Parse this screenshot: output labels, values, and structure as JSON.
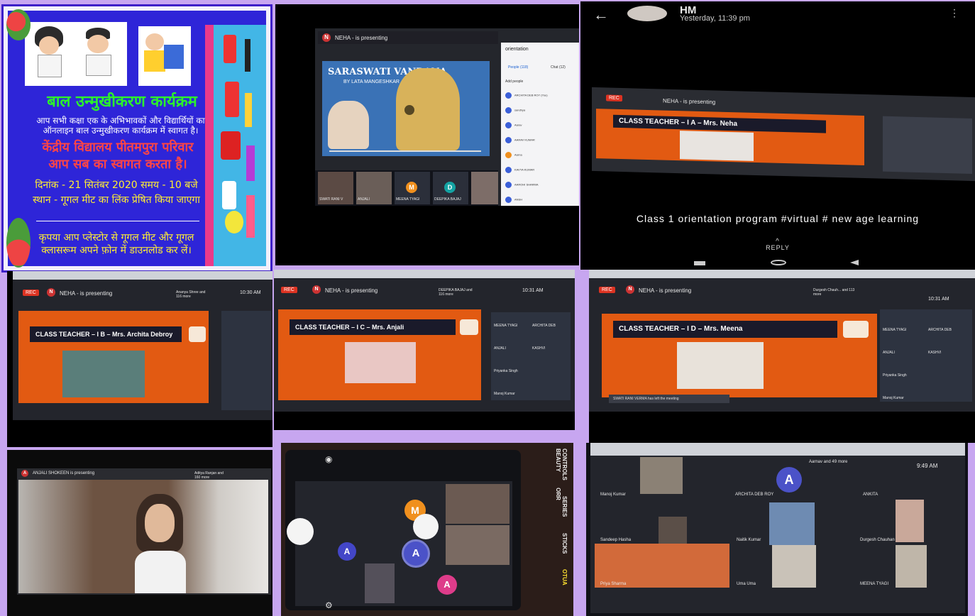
{
  "poster": {
    "title": "बाल उन्मुखीकरण कार्यक्रम",
    "line1": "आप सभी कक्षा एक के अभिभावकों और विद्यार्थियों का",
    "line2": "ऑनलाइन बाल उन्मुखीकरण कार्यक्रम में स्वागत है।",
    "school1": "केंद्रीय विद्यालय पीतमपुरा परिवार",
    "school2": "आप सब का स्वागत करता है।",
    "date": "दिनांक - 21 सितंबर 2020  समय - 10 बजे",
    "place": "स्थान - गूगल मीट का लिंक प्रेषित किया जाएगा",
    "note1": "कृपया आप प्लेस्टोर से गूगल मीट और गूगल",
    "note2": "क्लासरूम अपने फ़ोन में डाउनलोड कर लें।"
  },
  "vandana": {
    "presenter": "NEHA - is presenting",
    "video_title": "SARASWATI VANDANA",
    "video_sub": "BY LATA MANGESHKAR",
    "panel_title": "orientation",
    "tab_people": "People (118)",
    "tab_chat": "Chat (12)",
    "add_people": "Add people",
    "people": [
      "ARCHITA DEB ROY (You)",
      "sandhya",
      "Aarav",
      "AARAV KUMAR",
      "Aarna",
      "KAVYA KUMAR",
      "AAROHI SHARMA",
      "ANSH"
    ],
    "thumbs": [
      "SWATI RANI V",
      "ANJALI",
      "MEENA TYAGI",
      "DEEPIKA BAJAJ"
    ],
    "thumb_letters": [
      "M",
      "D"
    ]
  },
  "hm": {
    "name": "HM",
    "time": "Yesterday, 11:39 pm",
    "presenter": "NEHA - is presenting",
    "slide": "CLASS TEACHER – I A – Mrs. Neha",
    "caption": "Class 1 orientation program #virtual # new age learning",
    "reply": "REPLY"
  },
  "tileB": {
    "rec": "REC",
    "presenter": "NEHA - is presenting",
    "viewers": "Ananya Shree and 116 more",
    "clock": "10:30 AM",
    "slide": "CLASS TEACHER – I B – Mrs. Archita Debroy"
  },
  "tileC": {
    "rec": "REC",
    "presenter": "NEHA - is presenting",
    "viewers": "DEEPIKA BAJAJ and 116 more",
    "clock": "10:31 AM",
    "slide": "CLASS TEACHER – I C – Mrs. Anjali",
    "side": [
      "MEENA TYAGI",
      "ARCHITA DEB",
      "ANJALI",
      "KASHVI",
      "Priyanka Singh",
      "Manoj Kumar"
    ]
  },
  "tileD": {
    "rec": "REC",
    "presenter": "NEHA - is presenting",
    "viewers": "Durgesh Chauh... and 113 more",
    "clock": "10:31 AM",
    "slide": "CLASS TEACHER – I D – Mrs. Meena",
    "toast": "SWATI RANI VERMA has left the meeting",
    "side": [
      "MEENA TYAGI",
      "ARCHITA DEB",
      "ANJALI",
      "KASHVI",
      "Priyanka Singh",
      "Manoj Kumar"
    ]
  },
  "tileE": {
    "presenter": "ANJALI SHOKEEN is presenting",
    "viewers": "Aditya Ranjan and 160 more"
  },
  "tileF": {
    "letters": [
      "M",
      "A",
      "A",
      "A"
    ],
    "side_labels": [
      "CONTROLS",
      "SERIES",
      "STICKS",
      "OTUA",
      "BEAUTY",
      "ORR"
    ]
  },
  "tileG": {
    "viewers": "Aarnav and 49 more",
    "clock": "9:49 AM",
    "letter": "A",
    "names": [
      "Manoj Kumar",
      "ARCHITA DEB ROY",
      "ANKITA",
      "Sandeep Hasha",
      "Naitik Kumar",
      "Durgesh Chauhan",
      "Priya Sharma",
      "Uma Uma",
      "MEENA TYAGI"
    ]
  },
  "colors": {
    "background": "#c7a6f0",
    "slide_orange": "#e25a12",
    "poster_blue": "#2e25d8"
  }
}
